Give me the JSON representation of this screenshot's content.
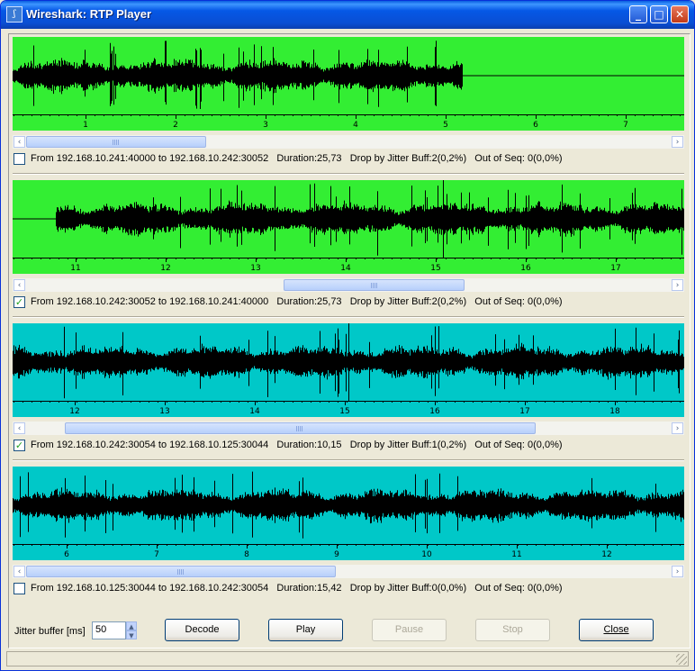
{
  "window": {
    "title": "Wireshark: RTP Player"
  },
  "streams": [
    {
      "color": "#33ee33",
      "ticks": [
        "1",
        "2",
        "3",
        "4",
        "5",
        "6",
        "7"
      ],
      "checked": false,
      "info": "From 192.168.10.241:40000 to 192.168.10.242:30052   Duration:25,73   Drop by Jitter Buff:2(0,2%)   Out of Seq: 0(0,0%)",
      "scroll_thumb": [
        0.0,
        0.28
      ],
      "cursor": null,
      "audio_end": 0.67,
      "lead_in": 0.0
    },
    {
      "color": "#33ee33",
      "ticks": [
        "11",
        "12",
        "13",
        "14",
        "15",
        "16",
        "17"
      ],
      "checked": true,
      "info": "From 192.168.10.242:30052 to 192.168.10.241:40000   Duration:25,73   Drop by Jitter Buff:2(0,2%)   Out of Seq: 0(0,0%)",
      "scroll_thumb": [
        0.4,
        0.68
      ],
      "cursor": 0.641,
      "audio_end": 1.0,
      "lead_in": 0.065
    },
    {
      "color": "#00c8c8",
      "ticks": [
        "12",
        "13",
        "14",
        "15",
        "16",
        "17",
        "18"
      ],
      "checked": true,
      "info": "From 192.168.10.242:30054 to 192.168.10.125:30044   Duration:10,15   Drop by Jitter Buff:1(0,2%)   Out of Seq: 0(0,0%)",
      "scroll_thumb": [
        0.06,
        0.79
      ],
      "cursor": 0.5,
      "audio_end": 1.0,
      "lead_in": 0.0
    },
    {
      "color": "#00c8c8",
      "ticks": [
        "6",
        "7",
        "8",
        "9",
        "10",
        "11",
        "12"
      ],
      "checked": false,
      "info": "From 192.168.10.125:30044 to 192.168.10.242:30054   Duration:15,42   Drop by Jitter Buff:0(0,0%)   Out of Seq: 0(0,0%)",
      "scroll_thumb": [
        0.0,
        0.48
      ],
      "cursor": null,
      "audio_end": 1.0,
      "lead_in": 0.0
    }
  ],
  "controls": {
    "jitter_label": "Jitter buffer [ms]",
    "jitter_value": "50",
    "decode": "Decode",
    "play": "Play",
    "pause": "Pause",
    "stop": "Stop",
    "close": "Close"
  }
}
